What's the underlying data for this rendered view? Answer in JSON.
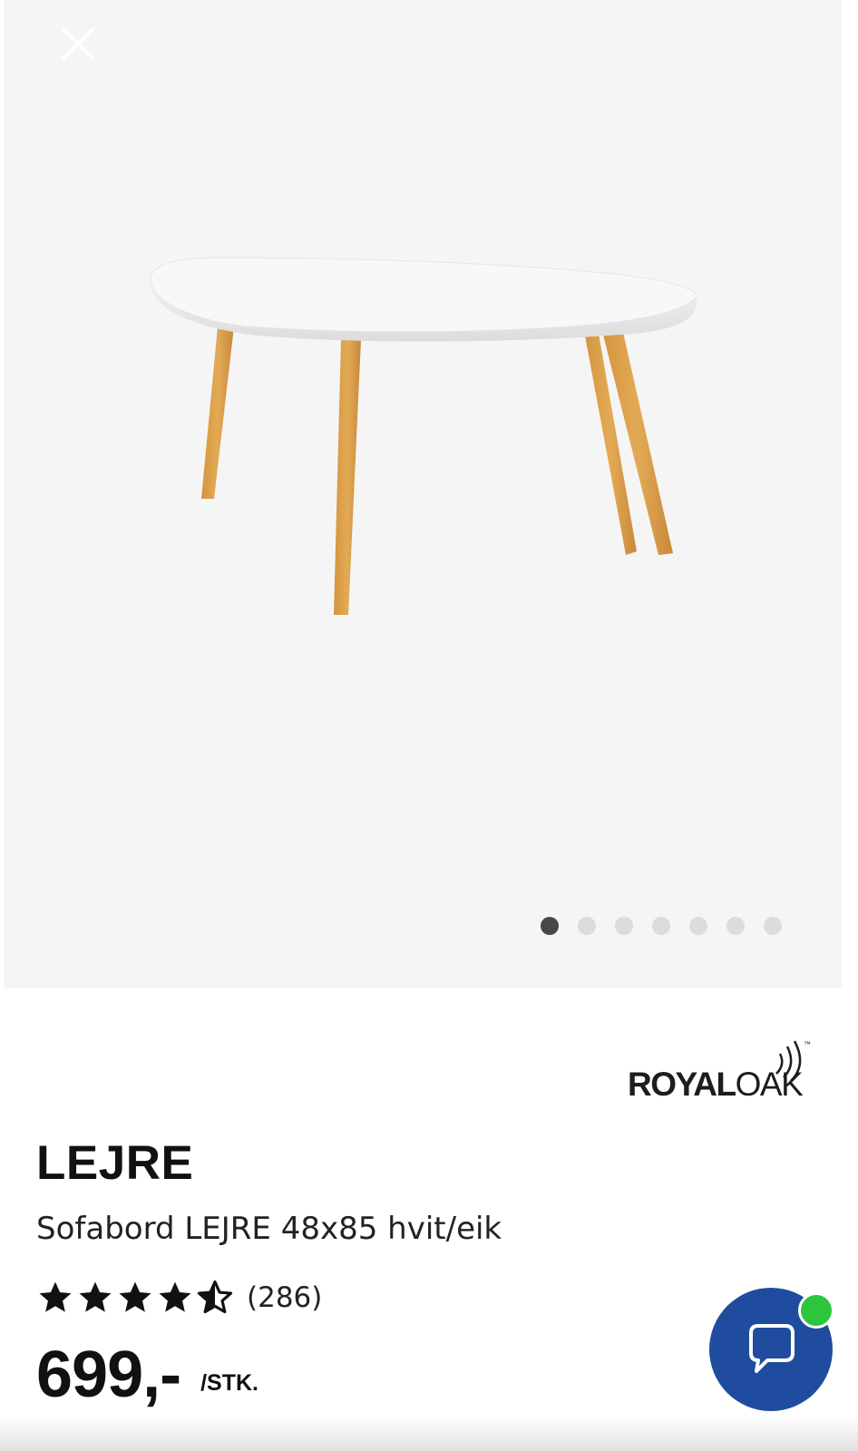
{
  "gallery": {
    "image_count": 7,
    "active_index": 0,
    "image_alt": "Sofabord LEJRE 48x85 hvit/eik"
  },
  "brand": {
    "name_bold": "ROYAL",
    "name_light": "OAK",
    "trademark": "™"
  },
  "product": {
    "name": "LEJRE",
    "description": "Sofabord LEJRE 48x85 hvit/eik",
    "rating": 4.5,
    "review_count": "(286)",
    "price": "699,-",
    "unit": "/STK."
  },
  "colors": {
    "chat_button": "#1f4c9e",
    "online_indicator": "#2cc53c",
    "active_dot": "#484848"
  },
  "icons": {
    "close": "close-icon",
    "chat": "chat-bubble-icon"
  }
}
